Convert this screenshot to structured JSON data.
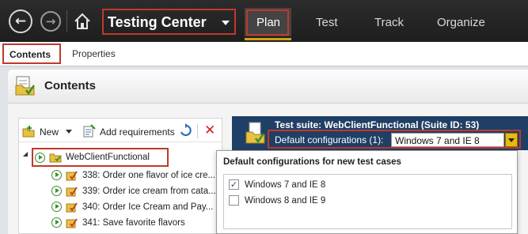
{
  "header": {
    "app_title": "Testing Center",
    "nav": [
      "Plan",
      "Test",
      "Track",
      "Organize"
    ],
    "back_glyph": "←",
    "forward_glyph": "→"
  },
  "subnav": {
    "contents": "Contents",
    "properties": "Properties"
  },
  "panel": {
    "title": "Contents"
  },
  "toolbar": {
    "new_label": "New",
    "add_requirements_label": "Add requirements",
    "delete_glyph": "✕"
  },
  "tree": {
    "root": "WebClientFunctional",
    "items": [
      "338: Order one flavor of ice cre...",
      "339: Order ice cream from cata...",
      "340: Order Ice Cream and Pay...",
      "341: Save favorite flavors"
    ]
  },
  "suite": {
    "title": "Test suite: WebClientFunctional (Suite ID: 53)",
    "config_label": "Default configurations (1):",
    "config_value": "Windows 7 and IE 8"
  },
  "popup": {
    "title": "Default configurations for new test cases",
    "options": [
      {
        "label": "Windows 7 and IE 8",
        "checked": true
      },
      {
        "label": "Windows 8 and IE 9",
        "checked": false
      }
    ]
  },
  "colors": {
    "header_bg": "#1e1e1e",
    "highlight_border": "#c0392b",
    "suite_header_bg": "#1f3f66",
    "dropdown_accent": "#e8b90f",
    "plan_underline": "#d4a017"
  }
}
